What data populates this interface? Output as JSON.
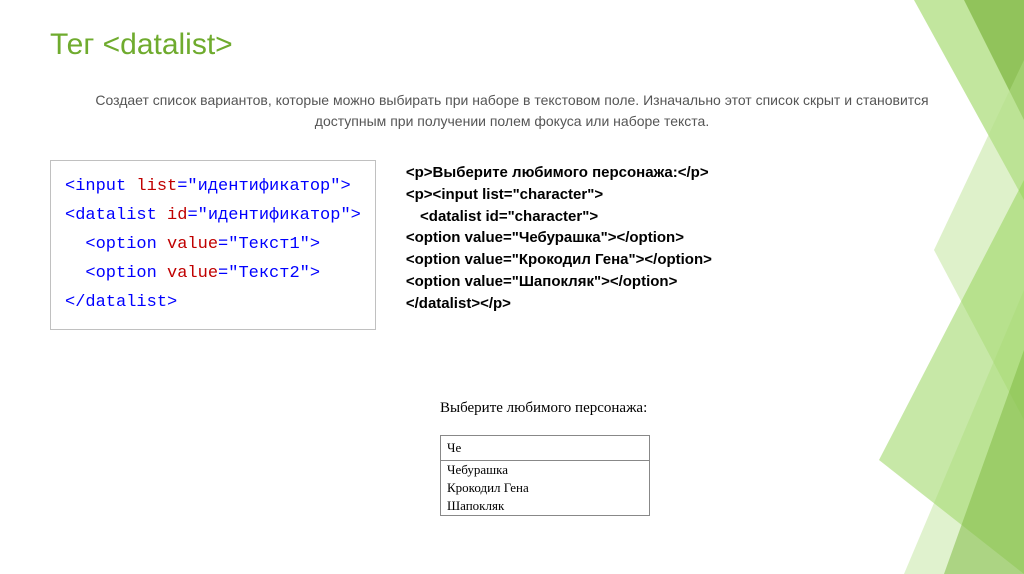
{
  "title_prefix": "Тег ",
  "title_tag": "<datalist>",
  "description": "Создает список вариантов, которые можно выбирать при наборе в текстовом поле. Изначально этот список скрыт и становится доступным при получении полем фокуса или наборе текста.",
  "syntax": {
    "l1_a": "<input ",
    "l1_b": "list",
    "l1_c": "=\"",
    "l1_d": "идентификатор",
    "l1_e": "\">",
    "l2_a": "<datalist ",
    "l2_b": "id",
    "l2_c": "=\"",
    "l2_d": "идентификатор",
    "l2_e": "\">",
    "l3_a": "  <option ",
    "l3_b": "value",
    "l3_c": "=\"",
    "l3_d": "Текст1",
    "l3_e": "\">",
    "l4_a": "  <option ",
    "l4_b": "value",
    "l4_c": "=\"",
    "l4_d": "Текст2",
    "l4_e": "\">",
    "l5": "</datalist>"
  },
  "example": {
    "l1": "<p>Выберите любимого персонажа:</p>",
    "l2": "<p><input list=\"character\">",
    "l3": " <datalist id=\"character\">",
    "l4": "<option value=\"Чебурашка\"></option>",
    "l5": "<option value=\"Крокодил Гена\"></option>",
    "l6": "<option value=\"Шапокляк\"></option>",
    "l7": "</datalist></p>"
  },
  "demo": {
    "label": "Выберите любимого персонажа:",
    "input_value": "Че",
    "options": [
      "Чебурашка",
      "Крокодил Гена",
      "Шапокляк"
    ]
  }
}
